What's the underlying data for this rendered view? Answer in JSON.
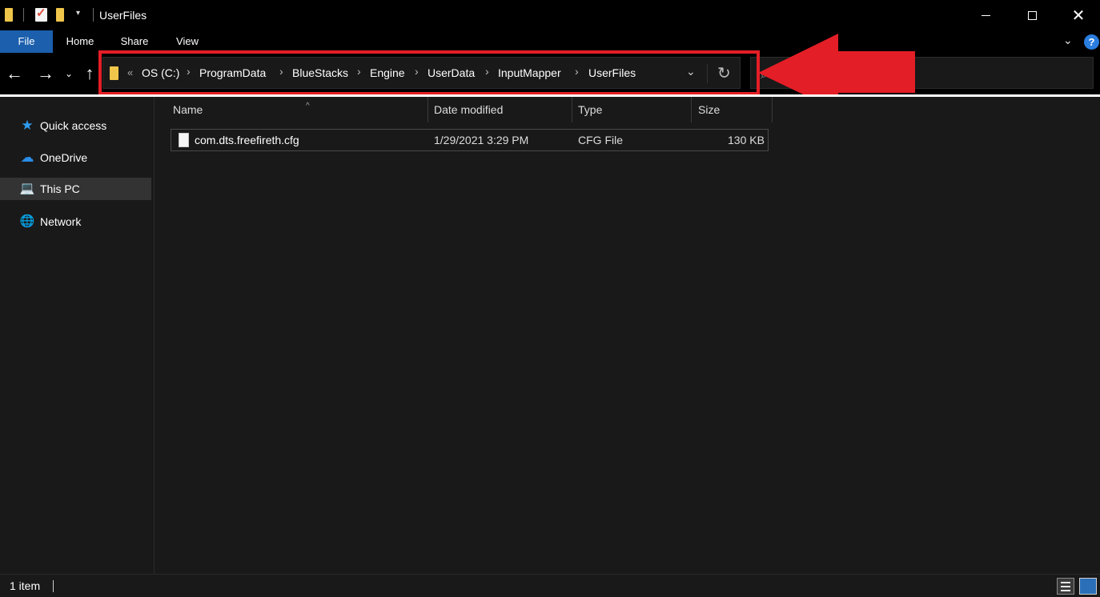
{
  "window": {
    "title": "UserFiles",
    "controls": {
      "minimize_icon": "minimize-icon",
      "maximize_icon": "maximize-icon",
      "close_glyph": "✕"
    }
  },
  "ribbon": {
    "tabs": [
      {
        "label": "File",
        "active": true
      },
      {
        "label": "Home"
      },
      {
        "label": "Share"
      },
      {
        "label": "View"
      }
    ],
    "help_glyph": "?",
    "expand_glyph": "⌄"
  },
  "nav": {
    "back_glyph": "←",
    "forward_glyph": "→",
    "recent_glyph": "⌄",
    "up_glyph": "↑"
  },
  "address": {
    "overflow_glyph": "«",
    "separator_glyph": "›",
    "dropdown_glyph": "⌄",
    "refresh_glyph": "↻",
    "crumbs": [
      "OS (C:)",
      "ProgramData",
      "BlueStacks",
      "Engine",
      "UserData",
      "InputMapper",
      "UserFiles"
    ]
  },
  "search": {
    "icon": "search-icon"
  },
  "sidebar": {
    "items": [
      {
        "label": "Quick access",
        "icon": "star-icon",
        "glyph": "★",
        "color": "#2f9cf0"
      },
      {
        "label": "OneDrive",
        "icon": "cloud-icon",
        "glyph": "☁",
        "color": "#2a8ce6"
      },
      {
        "label": "This PC",
        "icon": "computer-icon",
        "glyph": "💻",
        "color": "#7fb4e6",
        "selected": true
      },
      {
        "label": "Network",
        "icon": "network-icon",
        "glyph": "🌐",
        "color": "#4aa3e8"
      }
    ]
  },
  "file_list": {
    "sort_glyph": "^",
    "columns": [
      "Name",
      "Date modified",
      "Type",
      "Size"
    ],
    "rows": [
      {
        "name": "com.dts.freefireth.cfg",
        "date_modified": "1/29/2021 3:29 PM",
        "type": "CFG File",
        "size": "130 KB",
        "icon": "file-icon"
      }
    ]
  },
  "status": {
    "item_count": "1 item"
  },
  "annotation": {
    "highlight_color": "#e41e26",
    "arrow_icon": "red-arrow-icon"
  },
  "colors": {
    "background": "#191919",
    "chrome": "#000000",
    "accent": "#1b5fad",
    "folder": "#f0c64a"
  }
}
